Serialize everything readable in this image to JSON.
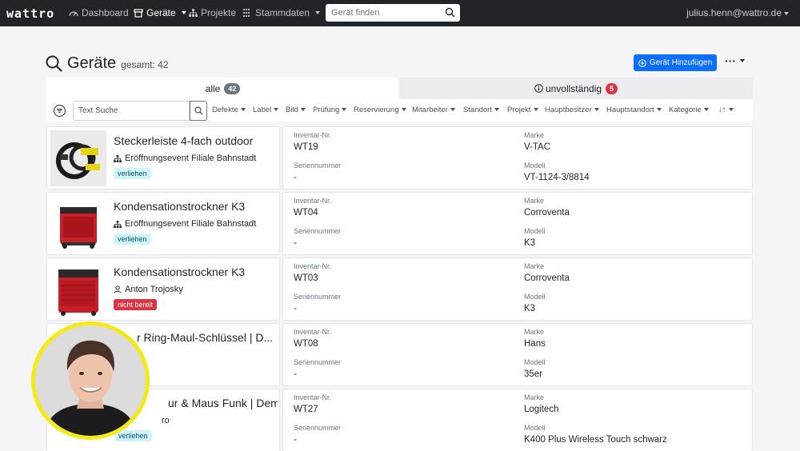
{
  "nav": {
    "brand": "wattro",
    "items": [
      {
        "label": "Dashboard",
        "icon": "dashboard-icon"
      },
      {
        "label": "Geräte",
        "icon": "box-icon"
      },
      {
        "label": "Projekte",
        "icon": "sitemap-icon"
      },
      {
        "label": "Stammdaten",
        "icon": "list-icon"
      }
    ],
    "search_placeholder": "Gerät finden",
    "user": "julius.henn@wattro.de"
  },
  "header": {
    "title": "Geräte",
    "total": "gesamt: 42",
    "add_button": "Gerät Hinzufügen",
    "more": "···"
  },
  "tabs": [
    {
      "label": "alle",
      "count": "42"
    },
    {
      "label": "unvollständig",
      "count": "5"
    }
  ],
  "filters": {
    "text_search": "Text Suche",
    "dropdowns": [
      "Defekte",
      "Label",
      "Bild",
      "Prüfung",
      "Reservierung",
      "Mitarbeiter",
      "Standort",
      "Projekt",
      "Hauptbesitzer",
      "Hauptstandort",
      "Kategorie",
      "↓↑"
    ]
  },
  "field_labels": {
    "inventory": "Inventar-Nr.",
    "serial": "Seriennummer",
    "brand": "Marke",
    "model": "Modell"
  },
  "devices": [
    {
      "name": "Steckerleiste 4-fach outdoor",
      "location": "Eröffnungsevent Filiale Bahnstadt",
      "status": "verliehen",
      "inventory": "WT19",
      "serial": "-",
      "brand": "V-TAC",
      "model": "VT-1124-3/8814"
    },
    {
      "name": "Kondensationstrockner K3",
      "location": "Eröffnungsevent Filiale Bahnstadt",
      "status": "verliehen",
      "inventory": "WT04",
      "serial": "-",
      "brand": "Corroventa",
      "model": "K3"
    },
    {
      "name": "Kondensationstrockner K3",
      "location": "Anton Trojosky",
      "status": "nicht bereit",
      "inventory": "WT03",
      "serial": "-",
      "brand": "Corroventa",
      "model": "K3"
    },
    {
      "name": "r Ring-Maul-Schlüssel | D...",
      "location": "",
      "status": "",
      "inventory": "WT08",
      "serial": "-",
      "brand": "Hans",
      "model": "35er"
    },
    {
      "name": "ur & Maus Funk | Demo...",
      "location": "ro",
      "status": "verliehen",
      "inventory": "WT27",
      "serial": "-",
      "brand": "Logitech",
      "model": "K400 Plus Wireless Touch schwarz"
    }
  ],
  "colors": {
    "primary": "#0d6efd",
    "danger": "#dc3545",
    "info_bg": "#cff4fc",
    "navbar": "#212529",
    "webcam_ring": "#f5ea14"
  }
}
